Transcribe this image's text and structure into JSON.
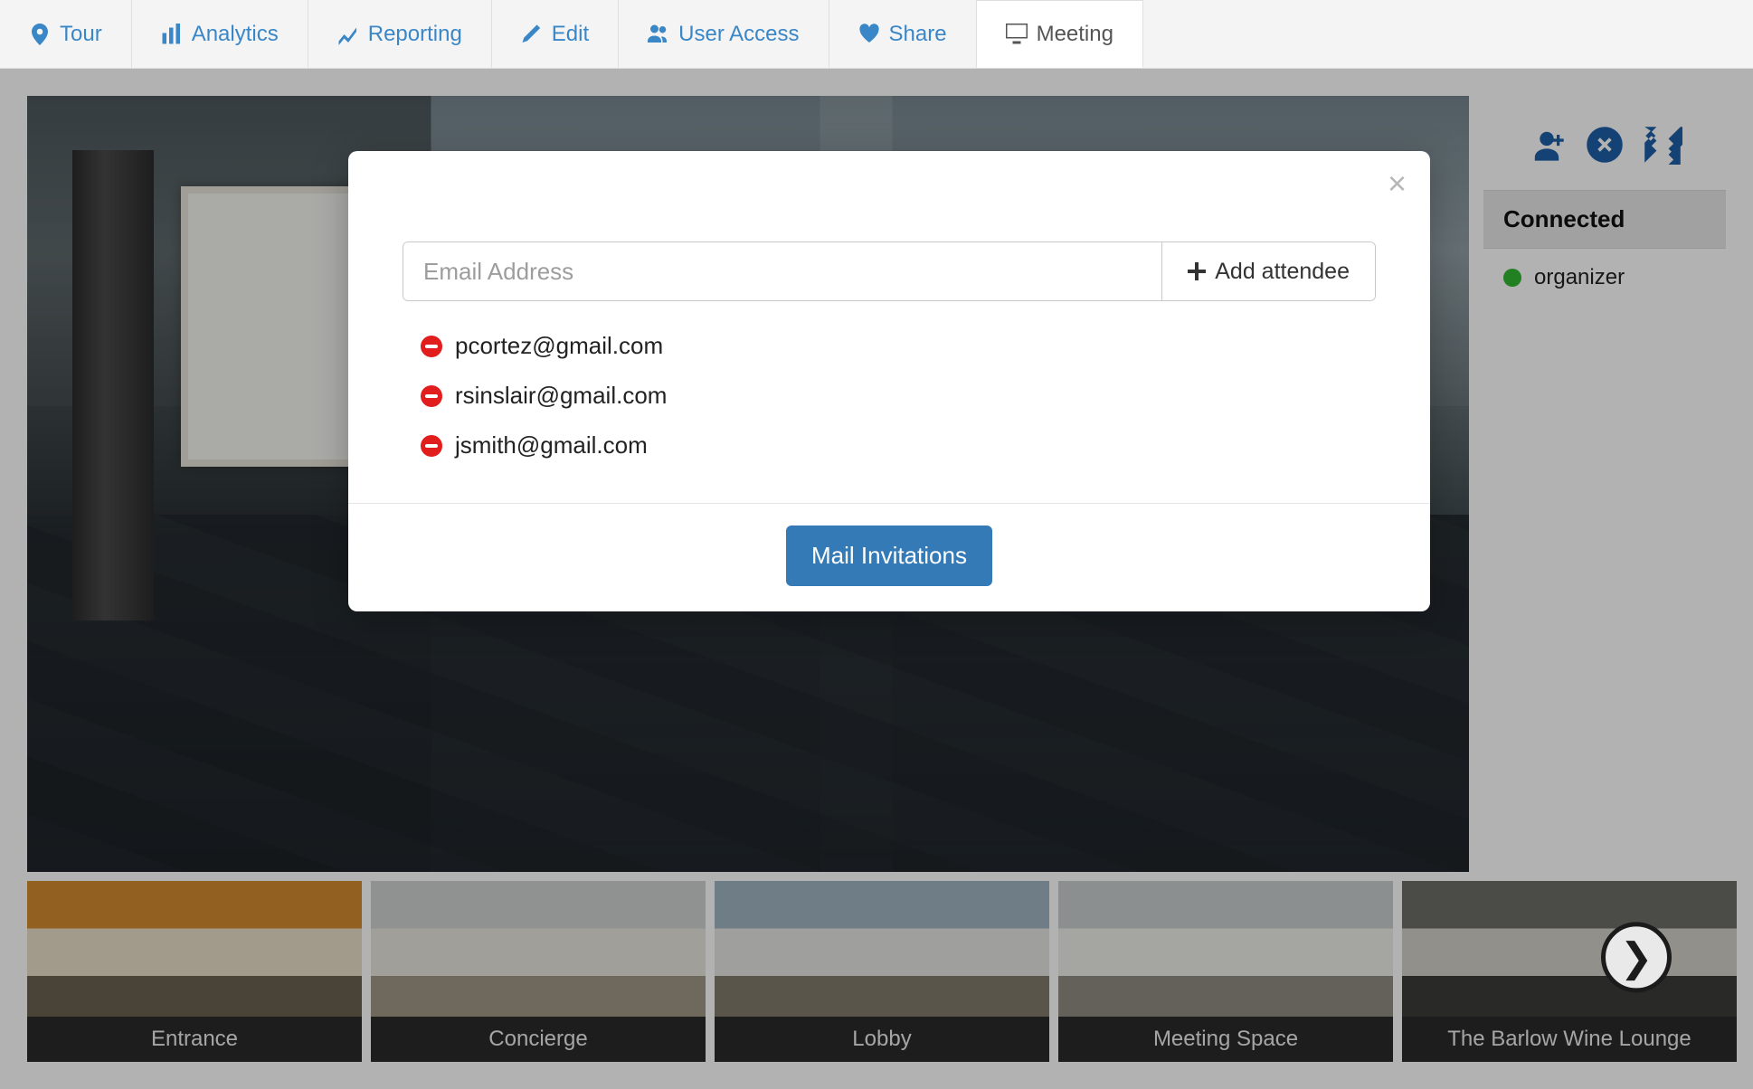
{
  "tabs": [
    {
      "icon": "pin",
      "label": "Tour"
    },
    {
      "icon": "bars",
      "label": "Analytics"
    },
    {
      "icon": "chart",
      "label": "Reporting"
    },
    {
      "icon": "pencil",
      "label": "Edit"
    },
    {
      "icon": "users",
      "label": "User Access"
    },
    {
      "icon": "heart",
      "label": "Share"
    },
    {
      "icon": "monitor",
      "label": "Meeting"
    }
  ],
  "activeTabIndex": 6,
  "sidebar": {
    "title": "Connected",
    "participants": [
      {
        "status": "online",
        "name": "organizer"
      }
    ],
    "actions": [
      {
        "name": "invite-user",
        "icon": "user-plus"
      },
      {
        "name": "close-session",
        "icon": "circle-x"
      },
      {
        "name": "fullscreen",
        "icon": "expand"
      }
    ]
  },
  "thumbnails": [
    {
      "label": "Entrance"
    },
    {
      "label": "Concierge"
    },
    {
      "label": "Lobby"
    },
    {
      "label": "Meeting Space"
    },
    {
      "label": "The Barlow Wine Lounge"
    }
  ],
  "modal": {
    "email_placeholder": "Email Address",
    "add_label": "Add attendee",
    "attendees": [
      "pcortez@gmail.com",
      "rsinslair@gmail.com",
      "jsmith@gmail.com"
    ],
    "mail_label": "Mail Invitations"
  }
}
